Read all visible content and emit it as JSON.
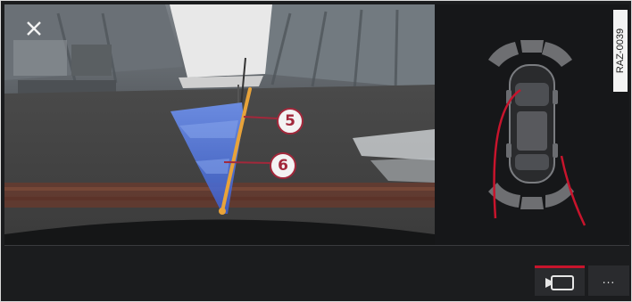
{
  "camera_view": {
    "close_icon": "close-icon",
    "guidance": {
      "side_guide_color": "#4a6fd6",
      "trajectory_color": "#e8a33a",
      "callout_border_color": "#a2283b"
    },
    "callouts": [
      {
        "label": "5"
      },
      {
        "label": "6"
      }
    ]
  },
  "top_view": {
    "reference_code": "RAZ-0039",
    "trajectory_color": "#c8142c"
  },
  "bottom_bar": {
    "camera_mode_icon": "rear-camera-icon",
    "camera_mode_active_color": "#c8142c",
    "more_label": "...",
    "more_icon": "more-icon"
  }
}
